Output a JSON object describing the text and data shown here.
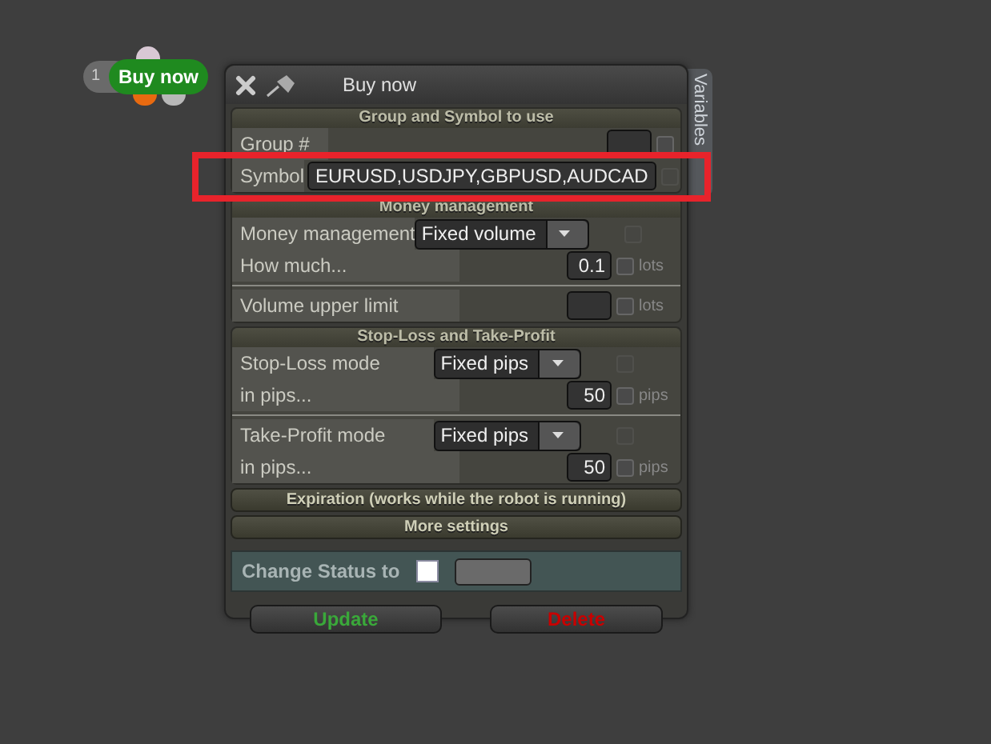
{
  "node": {
    "index": "1",
    "label": "Buy now"
  },
  "window": {
    "title": "Buy now",
    "side_tab": "Variables"
  },
  "sections": [
    {
      "kind": "symbol",
      "header": "Group and Symbol to use",
      "rows": [
        {
          "kind": "input",
          "label": "Group #",
          "checkbox": {
            "checked": false,
            "disabled": false
          }
        },
        {
          "kind": "wide-input",
          "label": "Symbol",
          "value": "EURUSD,USDJPY,GBPUSD,AUDCAD",
          "checkbox": {
            "checked": false,
            "disabled": true
          }
        }
      ]
    },
    {
      "kind": "settings",
      "header": "Money management",
      "rows": [
        {
          "kind": "dropdown",
          "label": "Money management",
          "value": "Fixed volume",
          "checkbox": {
            "checked": false,
            "disabled": true
          }
        },
        {
          "kind": "input",
          "label": "How much...",
          "value": "0.1",
          "unit": "lots",
          "checkbox": {
            "checked": false,
            "disabled": false
          }
        },
        {
          "kind": "separator"
        },
        {
          "kind": "input",
          "label": "Volume upper limit",
          "unit": "lots",
          "checkbox": {
            "checked": false,
            "disabled": false
          }
        }
      ]
    },
    {
      "kind": "settings",
      "header": "Stop-Loss and Take-Profit",
      "rows": [
        {
          "kind": "dropdown",
          "label": "Stop-Loss mode",
          "value": "Fixed pips",
          "checkbox": {
            "checked": false,
            "disabled": true
          }
        },
        {
          "kind": "input",
          "label": "in pips...",
          "value": "50",
          "unit": "pips",
          "checkbox": {
            "checked": false,
            "disabled": false
          }
        },
        {
          "kind": "separator"
        },
        {
          "kind": "dropdown",
          "label": "Take-Profit mode",
          "value": "Fixed pips",
          "checkbox": {
            "checked": false,
            "disabled": true
          }
        },
        {
          "kind": "input",
          "label": "in pips...",
          "value": "50",
          "unit": "pips",
          "checkbox": {
            "checked": false,
            "disabled": false
          }
        }
      ]
    },
    {
      "kind": "collapsed",
      "header": "Expiration (works while the robot is running)"
    },
    {
      "kind": "collapsed",
      "header": "More settings"
    }
  ],
  "status": {
    "label": "Change Status to",
    "checked": false
  },
  "buttons": [
    {
      "label": "Update",
      "kind": "confirm"
    },
    {
      "label": "Delete",
      "kind": "danger"
    }
  ],
  "highlight": {
    "shown": true
  }
}
